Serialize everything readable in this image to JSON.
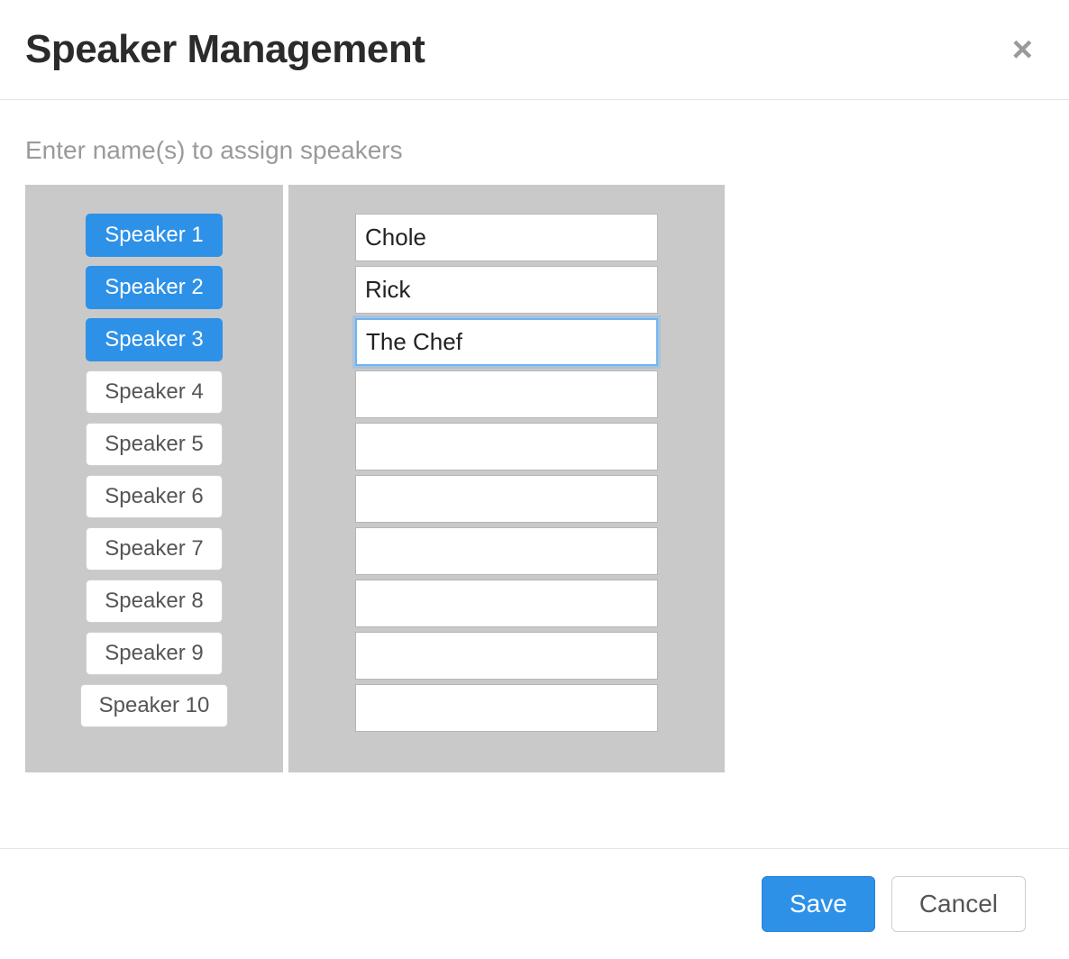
{
  "modal": {
    "title": "Speaker Management",
    "instructions": "Enter name(s) to assign speakers",
    "close_glyph": "×"
  },
  "speakers": [
    {
      "label": "Speaker 1",
      "active": true,
      "name": "Chole",
      "focused": false
    },
    {
      "label": "Speaker 2",
      "active": true,
      "name": "Rick",
      "focused": false
    },
    {
      "label": "Speaker 3",
      "active": true,
      "name": "The Chef",
      "focused": true
    },
    {
      "label": "Speaker 4",
      "active": false,
      "name": "",
      "focused": false
    },
    {
      "label": "Speaker 5",
      "active": false,
      "name": "",
      "focused": false
    },
    {
      "label": "Speaker 6",
      "active": false,
      "name": "",
      "focused": false
    },
    {
      "label": "Speaker 7",
      "active": false,
      "name": "",
      "focused": false
    },
    {
      "label": "Speaker 8",
      "active": false,
      "name": "",
      "focused": false
    },
    {
      "label": "Speaker 9",
      "active": false,
      "name": "",
      "focused": false
    },
    {
      "label": "Speaker 10",
      "active": false,
      "name": "",
      "focused": false
    }
  ],
  "actions": {
    "save": "Save",
    "cancel": "Cancel"
  }
}
